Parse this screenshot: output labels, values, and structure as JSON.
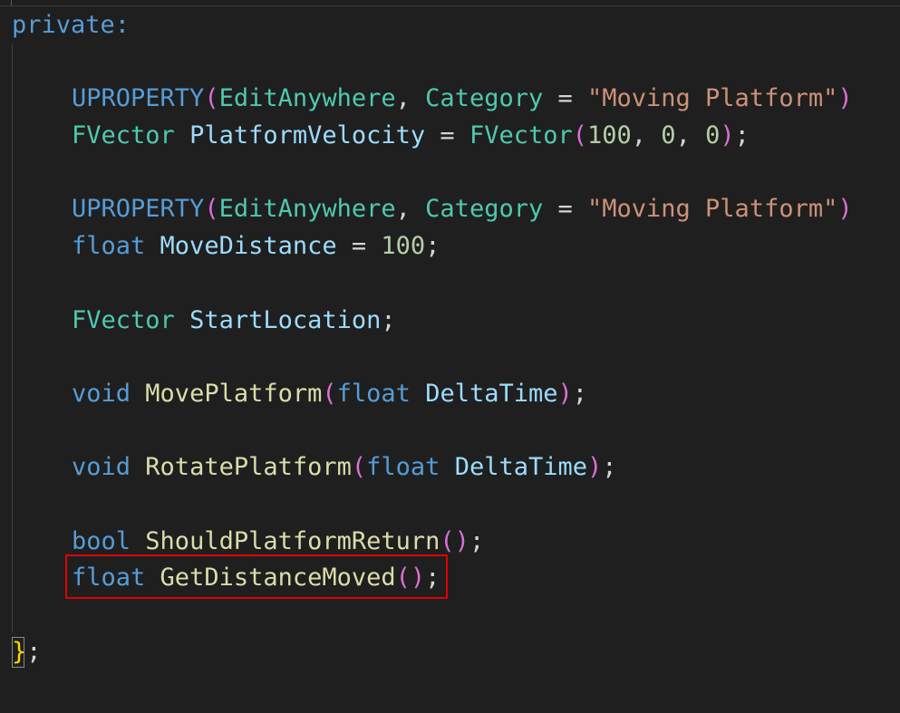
{
  "editor": {
    "language": "cpp",
    "lines": [
      {
        "indent": 0,
        "tokens": [
          {
            "t": "private",
            "c": "kw"
          },
          {
            "t": ":",
            "c": "kw"
          }
        ]
      },
      {
        "indent": 0,
        "tokens": []
      },
      {
        "indent": 1,
        "tokens": [
          {
            "t": "UPROPERTY",
            "c": "kw"
          },
          {
            "t": "(",
            "c": "p1"
          },
          {
            "t": "EditAnywhere",
            "c": "type"
          },
          {
            "t": ", ",
            "c": "punc"
          },
          {
            "t": "Category",
            "c": "type"
          },
          {
            "t": " = ",
            "c": "punc"
          },
          {
            "t": "\"Moving Platform\"",
            "c": "str"
          },
          {
            "t": ")",
            "c": "p1"
          }
        ]
      },
      {
        "indent": 1,
        "tokens": [
          {
            "t": "FVector",
            "c": "type"
          },
          {
            "t": " ",
            "c": "punc"
          },
          {
            "t": "PlatformVelocity",
            "c": "var"
          },
          {
            "t": " = ",
            "c": "punc"
          },
          {
            "t": "FVector",
            "c": "type"
          },
          {
            "t": "(",
            "c": "p1"
          },
          {
            "t": "100",
            "c": "num"
          },
          {
            "t": ", ",
            "c": "punc"
          },
          {
            "t": "0",
            "c": "num"
          },
          {
            "t": ", ",
            "c": "punc"
          },
          {
            "t": "0",
            "c": "num"
          },
          {
            "t": ")",
            "c": "p1"
          },
          {
            "t": ";",
            "c": "punc"
          }
        ]
      },
      {
        "indent": 0,
        "tokens": []
      },
      {
        "indent": 1,
        "tokens": [
          {
            "t": "UPROPERTY",
            "c": "kw"
          },
          {
            "t": "(",
            "c": "p1"
          },
          {
            "t": "EditAnywhere",
            "c": "type"
          },
          {
            "t": ", ",
            "c": "punc"
          },
          {
            "t": "Category",
            "c": "type"
          },
          {
            "t": " = ",
            "c": "punc"
          },
          {
            "t": "\"Moving Platform\"",
            "c": "str"
          },
          {
            "t": ")",
            "c": "p1"
          }
        ]
      },
      {
        "indent": 1,
        "tokens": [
          {
            "t": "float",
            "c": "kw"
          },
          {
            "t": " ",
            "c": "punc"
          },
          {
            "t": "MoveDistance",
            "c": "var"
          },
          {
            "t": " = ",
            "c": "punc"
          },
          {
            "t": "100",
            "c": "num"
          },
          {
            "t": ";",
            "c": "punc"
          }
        ]
      },
      {
        "indent": 0,
        "tokens": []
      },
      {
        "indent": 1,
        "tokens": [
          {
            "t": "FVector",
            "c": "type"
          },
          {
            "t": " ",
            "c": "punc"
          },
          {
            "t": "StartLocation",
            "c": "var"
          },
          {
            "t": ";",
            "c": "punc"
          }
        ]
      },
      {
        "indent": 0,
        "tokens": []
      },
      {
        "indent": 1,
        "tokens": [
          {
            "t": "void",
            "c": "kw"
          },
          {
            "t": " ",
            "c": "punc"
          },
          {
            "t": "MovePlatform",
            "c": "fn"
          },
          {
            "t": "(",
            "c": "p1"
          },
          {
            "t": "float",
            "c": "kw"
          },
          {
            "t": " ",
            "c": "punc"
          },
          {
            "t": "DeltaTime",
            "c": "var"
          },
          {
            "t": ")",
            "c": "p1"
          },
          {
            "t": ";",
            "c": "punc"
          }
        ]
      },
      {
        "indent": 0,
        "tokens": []
      },
      {
        "indent": 1,
        "tokens": [
          {
            "t": "void",
            "c": "kw"
          },
          {
            "t": " ",
            "c": "punc"
          },
          {
            "t": "RotatePlatform",
            "c": "fn"
          },
          {
            "t": "(",
            "c": "p1"
          },
          {
            "t": "float",
            "c": "kw"
          },
          {
            "t": " ",
            "c": "punc"
          },
          {
            "t": "DeltaTime",
            "c": "var"
          },
          {
            "t": ")",
            "c": "p1"
          },
          {
            "t": ";",
            "c": "punc"
          }
        ]
      },
      {
        "indent": 0,
        "tokens": []
      },
      {
        "indent": 1,
        "tokens": [
          {
            "t": "bool",
            "c": "kw"
          },
          {
            "t": " ",
            "c": "punc"
          },
          {
            "t": "ShouldPlatformReturn",
            "c": "fn"
          },
          {
            "t": "(",
            "c": "p1"
          },
          {
            "t": ")",
            "c": "p1"
          },
          {
            "t": ";",
            "c": "punc"
          }
        ]
      },
      {
        "indent": 1,
        "tokens": [
          {
            "t": "float",
            "c": "kw"
          },
          {
            "t": " ",
            "c": "punc"
          },
          {
            "t": "GetDistanceMoved",
            "c": "fn"
          },
          {
            "t": "(",
            "c": "p1"
          },
          {
            "t": ")",
            "c": "p1"
          },
          {
            "t": ";",
            "c": "punc"
          }
        ]
      },
      {
        "indent": 0,
        "tokens": []
      },
      {
        "indent": 0,
        "tokens": [
          {
            "t": "}",
            "c": "b0"
          },
          {
            "t": ";",
            "c": "punc"
          }
        ]
      }
    ]
  },
  "colors": {
    "background": "#1f1f1f",
    "keyword": "#569cd6",
    "type": "#4ec9b0",
    "variable": "#9cdcfe",
    "function": "#dcdcaa",
    "string": "#ce9178",
    "number": "#b5cea8",
    "bracket_level_1": "#da70d6",
    "bracket_level_0": "#ffd700",
    "highlight_box": "#e00000"
  }
}
